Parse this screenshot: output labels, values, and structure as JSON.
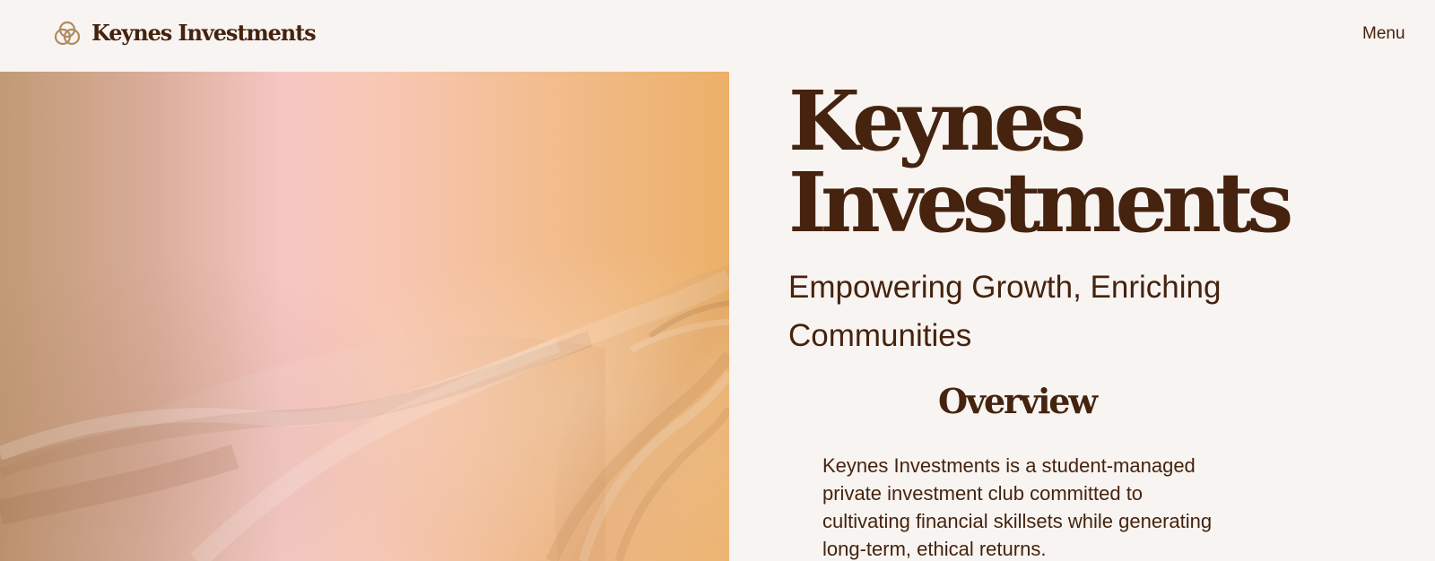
{
  "header": {
    "brand_name": "Keynes Investments",
    "menu_label": "Menu",
    "logo_icon": "interlocking-circles-logo-icon"
  },
  "hero": {
    "title_line_1": "Keynes",
    "title_line_2": "Investments",
    "tagline": "Empowering Growth, Enriching Communities"
  },
  "overview": {
    "heading": "Overview",
    "text": "Keynes Investments is a student-managed private investment club committed to cultivating financial skillsets while generating long-term, ethical returns."
  },
  "colors": {
    "background": "#f8f4f1",
    "text": "#45230f",
    "logo": "#b08b61",
    "image_gradient": [
      "#c29a76",
      "#f6c7c3",
      "#ecb068"
    ]
  }
}
